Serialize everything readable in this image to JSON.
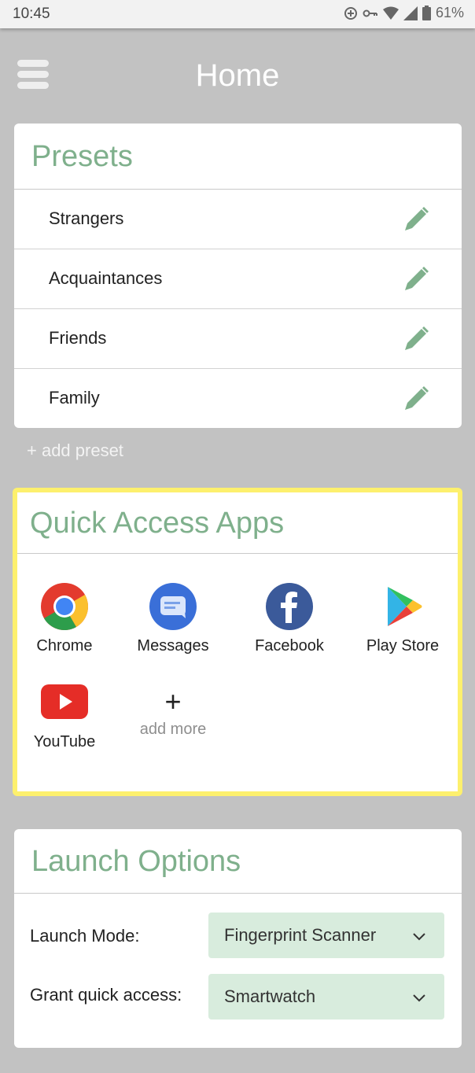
{
  "status_bar": {
    "time": "10:45",
    "battery": "61%",
    "icons": [
      "data-saver-icon",
      "vpn-key-icon",
      "wifi-icon",
      "cell-signal-icon",
      "battery-icon"
    ]
  },
  "header": {
    "title": "Home",
    "menu_icon": "hamburger-menu-icon"
  },
  "presets": {
    "title": "Presets",
    "items": [
      {
        "label": "Strangers",
        "icon": "pencil-icon"
      },
      {
        "label": "Acquaintances",
        "icon": "pencil-icon"
      },
      {
        "label": "Friends",
        "icon": "pencil-icon"
      },
      {
        "label": "Family",
        "icon": "pencil-icon"
      }
    ],
    "add_label": "+ add preset"
  },
  "quick_access": {
    "title": "Quick Access Apps",
    "apps": [
      {
        "label": "Chrome",
        "icon": "chrome-icon"
      },
      {
        "label": "Messages",
        "icon": "messages-icon"
      },
      {
        "label": "Facebook",
        "icon": "facebook-icon"
      },
      {
        "label": "Play Store",
        "icon": "play-store-icon"
      },
      {
        "label": "YouTube",
        "icon": "youtube-icon"
      }
    ],
    "add_more": {
      "symbol": "+",
      "label": "add more"
    }
  },
  "launch_options": {
    "title": "Launch Options",
    "launch_mode": {
      "label": "Launch Mode:",
      "value": "Fingerprint Scanner"
    },
    "grant_access": {
      "label": "Grant quick access:",
      "value": "Smartwatch"
    }
  },
  "colors": {
    "background": "#c2c2c2",
    "accent_green": "#7fb08c",
    "select_bg": "#d8ecdd",
    "highlight_yellow": "#fdf06d"
  }
}
